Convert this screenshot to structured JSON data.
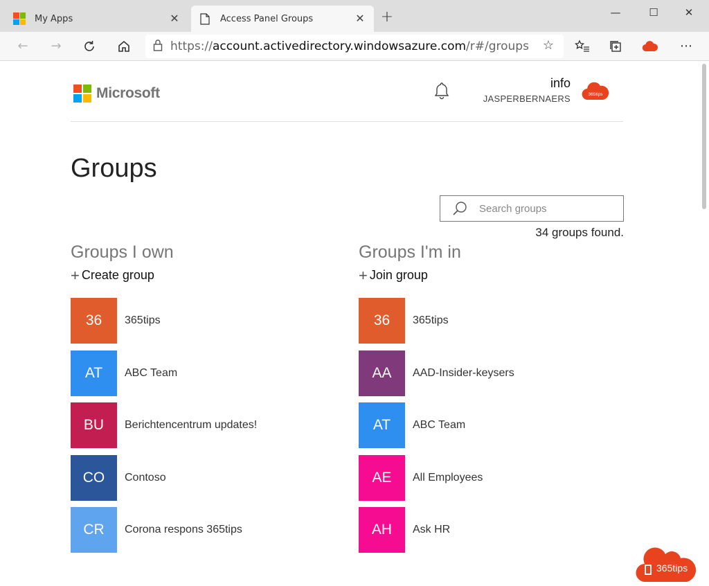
{
  "browser": {
    "tabs": [
      {
        "label": "My Apps",
        "active": false
      },
      {
        "label": "Access Panel Groups",
        "active": true
      }
    ],
    "url_prefix": "https://",
    "url_host": "account.activedirectory.windowsazure.com",
    "url_path": "/r#/groups",
    "icons": {
      "back": "back-arrow-icon",
      "forward": "forward-arrow-icon",
      "refresh": "refresh-icon",
      "home": "home-icon",
      "lock": "lock-icon",
      "favorite": "star-icon",
      "favorites_list": "favorites-icon",
      "collections": "collections-icon",
      "office_extension": "office-cloud-icon",
      "more": "more-icon"
    }
  },
  "header": {
    "logo_text": "Microsoft",
    "user_name": "info",
    "user_tenant": "JASPERBERNAERS",
    "avatar_text": "365tips",
    "accent": "#e8421e"
  },
  "page": {
    "title": "Groups",
    "search_placeholder": "Search groups",
    "result_count": "34 groups found."
  },
  "groups_own": {
    "heading": "Groups I own",
    "action_label": "Create group",
    "items": [
      {
        "initials": "36",
        "name": "365tips",
        "color": "#e05c2d"
      },
      {
        "initials": "AT",
        "name": "ABC Team",
        "color": "#2f8ff0"
      },
      {
        "initials": "BU",
        "name": "Berichtencentrum updates!",
        "color": "#c21e51"
      },
      {
        "initials": "CO",
        "name": "Contoso",
        "color": "#2b579a"
      },
      {
        "initials": "CR",
        "name": "Corona respons 365tips",
        "color": "#5fa4ee"
      }
    ]
  },
  "groups_in": {
    "heading": "Groups I'm in",
    "action_label": "Join group",
    "items": [
      {
        "initials": "36",
        "name": "365tips",
        "color": "#e05c2d"
      },
      {
        "initials": "AA",
        "name": "AAD-Insider-keysers",
        "color": "#80397b"
      },
      {
        "initials": "AT",
        "name": "ABC Team",
        "color": "#2f8ff0"
      },
      {
        "initials": "AE",
        "name": "All Employees",
        "color": "#f50c90"
      },
      {
        "initials": "AH",
        "name": "Ask HR",
        "color": "#f50c90"
      }
    ]
  },
  "watermark": {
    "text": "365tips",
    "color": "#e8421e"
  }
}
